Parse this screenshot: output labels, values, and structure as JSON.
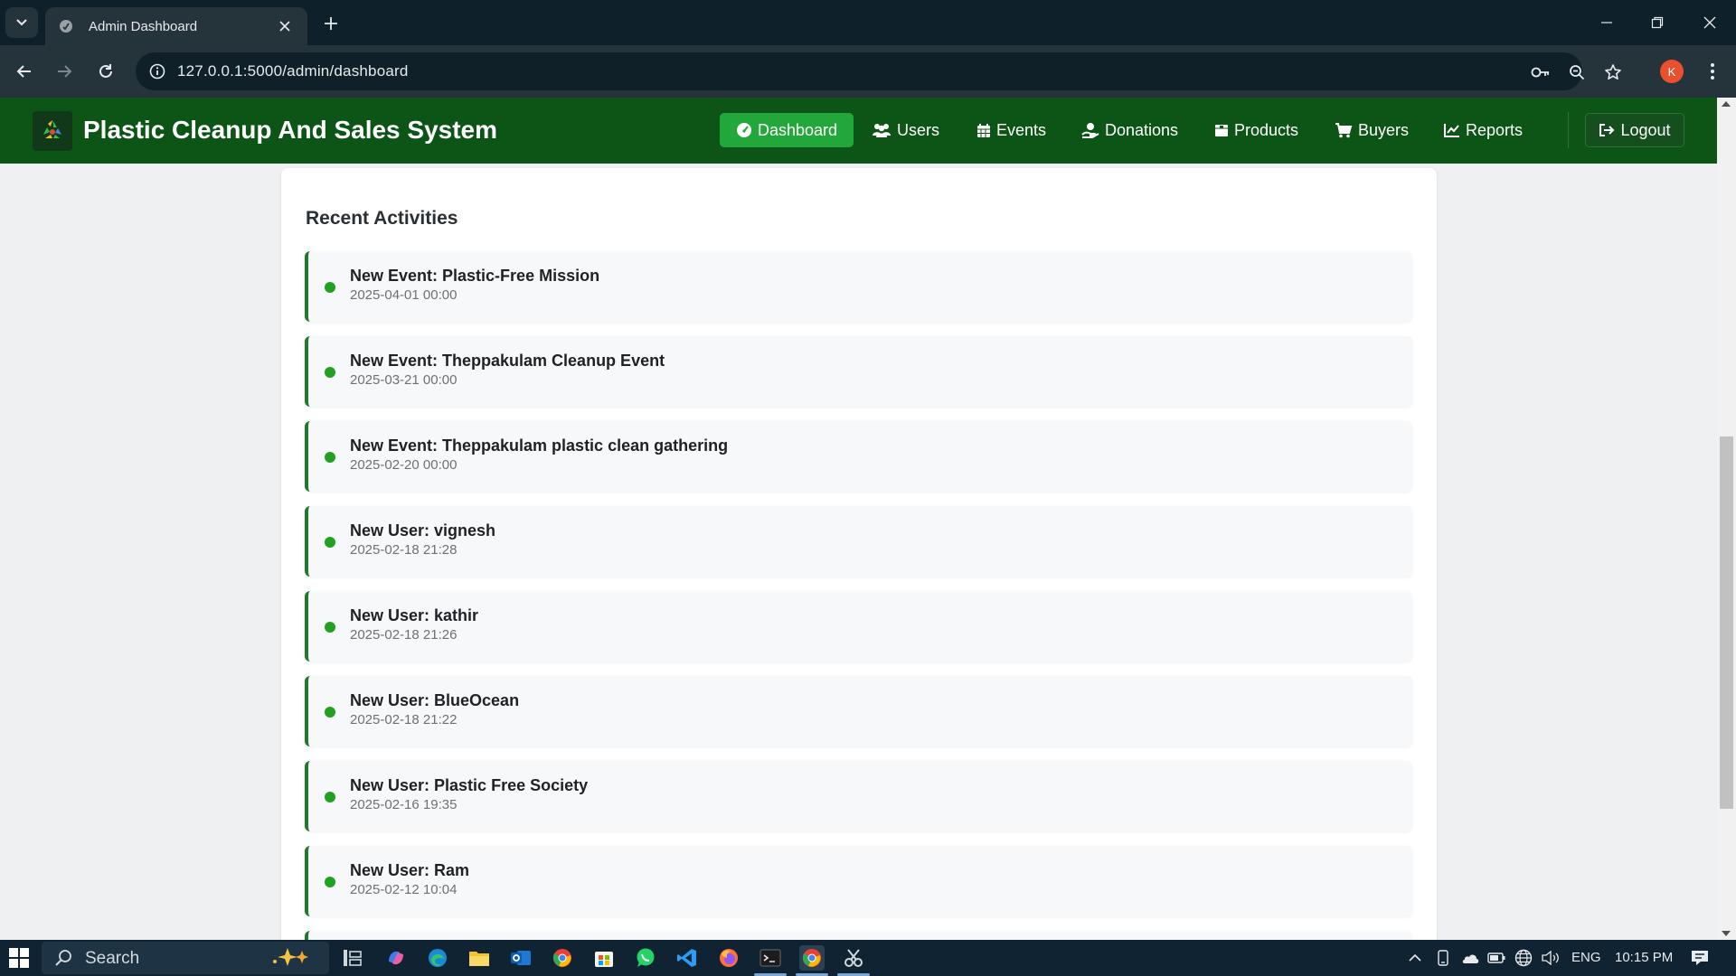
{
  "browser": {
    "tab_title": "Admin Dashboard",
    "url": "127.0.0.1:5000/admin/dashboard",
    "profile_initial": "K"
  },
  "navbar": {
    "brand": "Plastic Cleanup And Sales System",
    "links": [
      {
        "label": "Dashboard",
        "icon": "gauge-icon",
        "active": true
      },
      {
        "label": "Users",
        "icon": "users-icon",
        "active": false
      },
      {
        "label": "Events",
        "icon": "calendar-icon",
        "active": false
      },
      {
        "label": "Donations",
        "icon": "donate-icon",
        "active": false
      },
      {
        "label": "Products",
        "icon": "box-icon",
        "active": false
      },
      {
        "label": "Buyers",
        "icon": "cart-icon",
        "active": false
      },
      {
        "label": "Reports",
        "icon": "chart-line-icon",
        "active": false
      }
    ],
    "logout": "Logout"
  },
  "recent": {
    "title": "Recent Activities",
    "items": [
      {
        "title": "New Event: Plastic-Free Mission",
        "time": "2025-04-01 00:00"
      },
      {
        "title": "New Event: Theppakulam Cleanup Event",
        "time": "2025-03-21 00:00"
      },
      {
        "title": "New Event: Theppakulam plastic clean gathering",
        "time": "2025-02-20 00:00"
      },
      {
        "title": "New User: vignesh",
        "time": "2025-02-18 21:28"
      },
      {
        "title": "New User: kathir",
        "time": "2025-02-18 21:26"
      },
      {
        "title": "New User: BlueOcean",
        "time": "2025-02-18 21:22"
      },
      {
        "title": "New User: Plastic Free Society",
        "time": "2025-02-16 19:35"
      },
      {
        "title": "New User: Ram",
        "time": "2025-02-12 10:04"
      }
    ]
  },
  "taskbar": {
    "search": "Search",
    "lang": "ENG",
    "time": "10:15 PM"
  },
  "colors": {
    "navbar": "#0c5516",
    "active": "#22a83a",
    "accent_border": "#1f7a2c",
    "dot": "#22a01f"
  }
}
